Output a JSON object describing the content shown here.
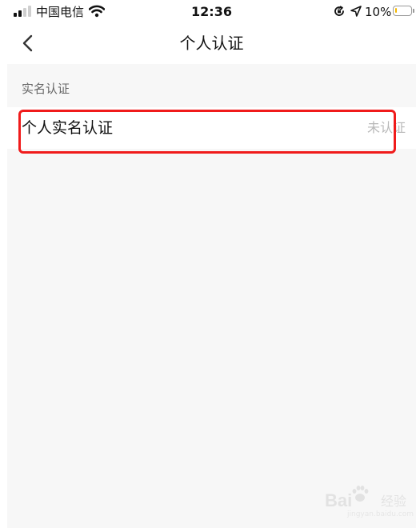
{
  "status_bar": {
    "carrier": "中国电信",
    "time": "12:36",
    "battery_percent_text": "10%",
    "battery_level": 0.1,
    "battery_color": "#f5b800",
    "icons": [
      "signal-icon",
      "wifi-icon",
      "orientation-lock-icon",
      "location-arrow-icon",
      "battery-icon"
    ]
  },
  "nav": {
    "title": "个人认证",
    "back_icon": "chevron-left-icon"
  },
  "section": {
    "header": "实名认证"
  },
  "rows": [
    {
      "label": "个人实名认证",
      "status": "未认证"
    }
  ],
  "colors": {
    "highlight": "#f01b1b",
    "page_background": "#f7f7f7",
    "status_text": "#b8b8b8"
  },
  "watermark": {
    "text": "Bai",
    "subtext": "经验",
    "url": "jingyan.baidu.com"
  }
}
